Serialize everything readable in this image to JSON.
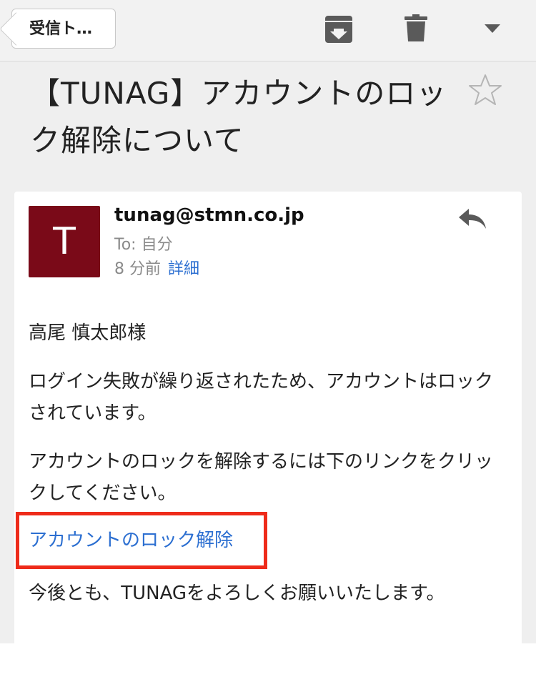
{
  "toolbar": {
    "back_label": "受信ト…",
    "icons": [
      "archive-icon",
      "trash-icon",
      "dropdown-icon"
    ]
  },
  "email": {
    "subject": "【TUNAG】アカウントのロック解除について",
    "starred": false,
    "sender": "tunag@stmn.co.jp",
    "avatar_letter": "T",
    "avatar_color": "#7a0a18",
    "to_line": "To: 自分",
    "time": "8 分前",
    "details_label": "詳細",
    "body": {
      "greeting": "高尾 慎太郎様",
      "locked": "ログイン失敗が繰り返されたため、アカウントはロックされています。",
      "instruct": "アカウントのロックを解除するには下のリンクをクリックしてください。",
      "unlock_link": "アカウントのロック解除",
      "closing": "今後とも、TUNAGをよろしくお願いいたします。"
    }
  },
  "colors": {
    "link": "#2c6fd1",
    "highlight": "#ee2b1a"
  }
}
